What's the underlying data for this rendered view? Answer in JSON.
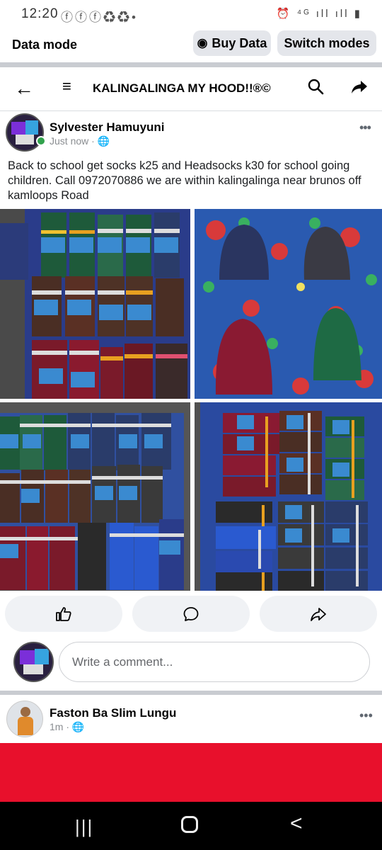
{
  "status_bar": {
    "time": "12:20",
    "left_icons": "ⓕⓕⓕ♻♻•",
    "right_icons": "⏰ ⁴ᴳ ıll ıll ▮"
  },
  "data_bar": {
    "label": "Data mode",
    "buy_data": "Buy Data",
    "switch_modes": "Switch modes"
  },
  "group_header": {
    "title": "KALINGALINGA MY HOOD!!®©"
  },
  "post": {
    "author": "Sylvester Hamuyuni",
    "time": "Just now",
    "separator": "·",
    "text": "Back to school get socks k25 and Headsocks k30 for school going children. Call 0972070886 we are within kalingalinga near brunos off kamloops Road",
    "photos": [
      {
        "subject": "school socks"
      },
      {
        "subject": "beanie hats"
      },
      {
        "subject": "school socks"
      },
      {
        "subject": "school socks"
      }
    ]
  },
  "actions": {
    "like_icon": "thumbs-up-icon",
    "comment_icon": "comment-icon",
    "share_icon": "share-icon"
  },
  "comment": {
    "placeholder": "Write a comment..."
  },
  "post2": {
    "author": "Faston Ba Slim Lungu",
    "time": "1m",
    "separator": "·"
  },
  "colors": {
    "accent_banner": "#e8102c",
    "online": "#31a24c",
    "pill_bg": "#e4e6eb"
  }
}
